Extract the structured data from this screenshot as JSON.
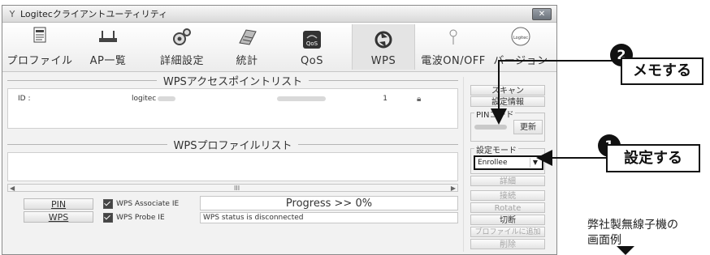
{
  "window": {
    "title": "Logitecクライアントユーティリティ",
    "close_label": "✕"
  },
  "toolbar": {
    "items": [
      {
        "label": "プロファイル",
        "icon": "profile-icon"
      },
      {
        "label": "AP一覧",
        "icon": "ap-list-icon"
      },
      {
        "label": "詳細設定",
        "icon": "advanced-settings-icon"
      },
      {
        "label": "統計",
        "icon": "statistics-icon"
      },
      {
        "label": "QoS",
        "icon": "qos-icon"
      },
      {
        "label": "WPS",
        "icon": "wps-icon"
      },
      {
        "label": "電波ON/OFF",
        "icon": "radio-onoff-icon"
      },
      {
        "label": "バージョン",
        "icon": "version-icon"
      }
    ],
    "qos_icon_text": "QoS",
    "version_icon_text": "Logitec"
  },
  "ap_list": {
    "title": "WPSアクセスポイントリスト",
    "row": {
      "id_label": "ID :",
      "ssid": "logitec",
      "channel": "1"
    }
  },
  "profile_list": {
    "title": "WPSプロファイルリスト"
  },
  "scrollbar": {
    "thumb": "III",
    "left": "◀",
    "right": "▶"
  },
  "bottom": {
    "pin_button": "PIN",
    "wps_button": "WPS",
    "associate_ie": "WPS Associate IE",
    "probe_ie": "WPS Probe IE",
    "progress": "Progress >> 0%",
    "status": "WPS status is disconnected"
  },
  "side": {
    "scan": "スキャン",
    "settings_info": "設定情報",
    "pin_code_label": "PINコード",
    "update": "更新",
    "mode_label": "設定モード",
    "mode_value": "Enrollee",
    "details": "詳細",
    "connect": "接続",
    "rotate": "Rotate",
    "disconnect": "切断",
    "add_profile": "プロファイルに追加",
    "delete": "削除"
  },
  "annotations": {
    "badge_2": "2",
    "memo": "メモする",
    "badge_1": "1",
    "setting": "設定する"
  },
  "caption": {
    "line1": "弊社製無線子機の",
    "line2": "画面例"
  }
}
